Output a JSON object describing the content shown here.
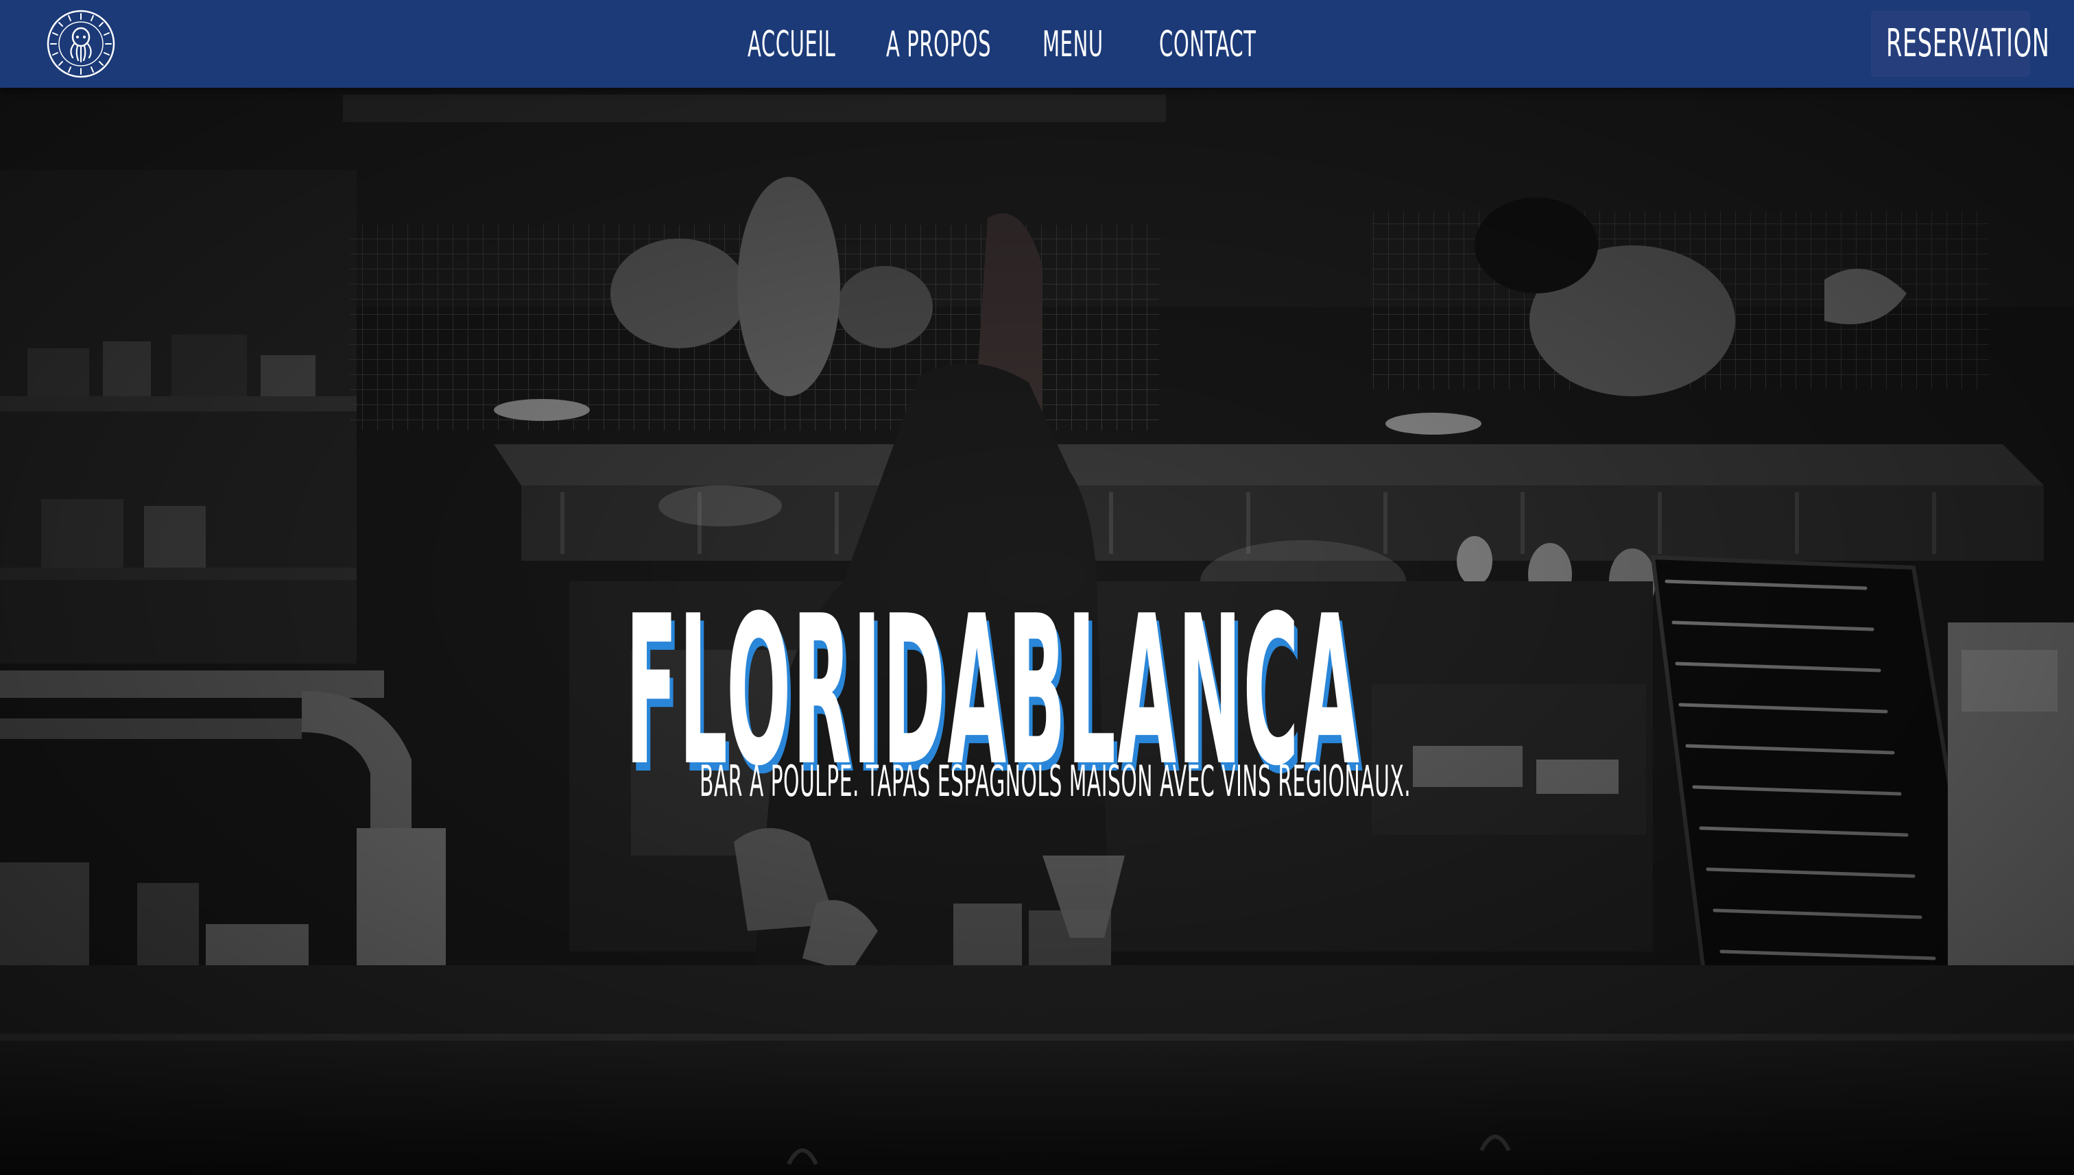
{
  "logo": {
    "text": "FLORIDABLANCA · RESTAURANT · BAR A POULPE",
    "icon": "octopus-seal-icon"
  },
  "nav": {
    "items": [
      {
        "label": "ACCUEIL"
      },
      {
        "label": "A PROPOS"
      },
      {
        "label": "MENU"
      },
      {
        "label": "CONTACT"
      }
    ],
    "reservation_label": "RESERVATION"
  },
  "hero": {
    "title": "FLORIDABLANCA",
    "subtitle": "BAR A POULPE. TAPAS ESPAGNOLS MAISON AVEC VINS REGIONAUX."
  },
  "colors": {
    "navbar": "#1c3a78",
    "reservation_bg": "#263f7c",
    "title_shadow": "#2a86d8",
    "text": "#ffffff"
  }
}
